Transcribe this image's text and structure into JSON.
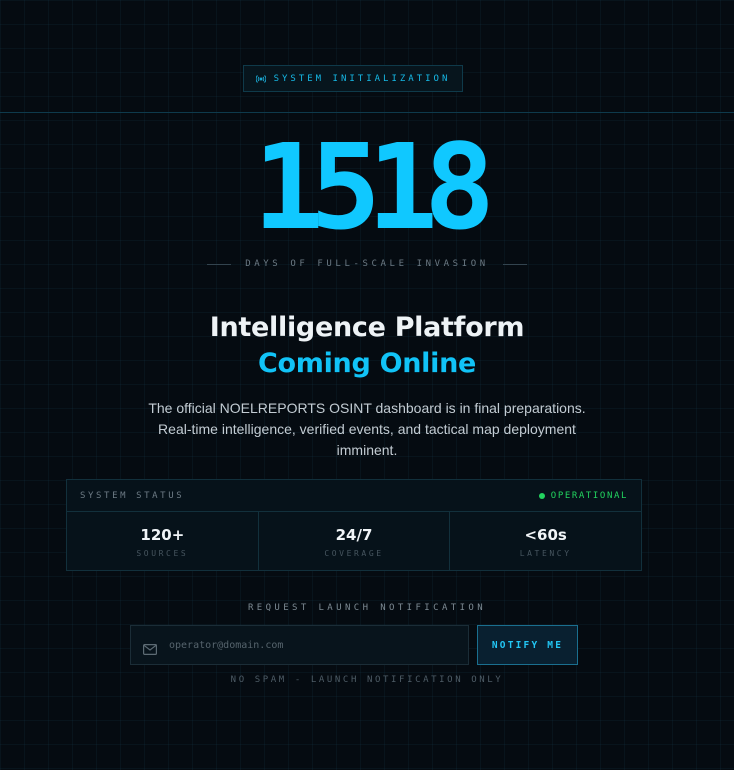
{
  "badge": {
    "icon": "broadcast-icon",
    "label": "SYSTEM INITIALIZATION"
  },
  "counter": {
    "value": "1518",
    "caption": "DAYS OF FULL-SCALE INVASION"
  },
  "headline": {
    "line1": "Intelligence Platform",
    "line2": "Coming Online"
  },
  "description": "The official NOELREPORTS OSINT dashboard is in final preparations. Real-time intelligence, verified events, and tactical map deployment imminent.",
  "status_panel": {
    "title": "SYSTEM STATUS",
    "status": "OPERATIONAL",
    "stats": [
      {
        "value": "120+",
        "label": "SOURCES"
      },
      {
        "value": "24/7",
        "label": "COVERAGE"
      },
      {
        "value": "<60s",
        "label": "LATENCY"
      }
    ]
  },
  "notify": {
    "heading": "REQUEST LAUNCH NOTIFICATION",
    "placeholder": "operator@domain.com",
    "button": "NOTIFY ME",
    "note": "NO SPAM - LAUNCH NOTIFICATION ONLY"
  },
  "colors": {
    "accent": "#10c8ff",
    "status_green": "#22d35f",
    "background": "#050b11"
  }
}
